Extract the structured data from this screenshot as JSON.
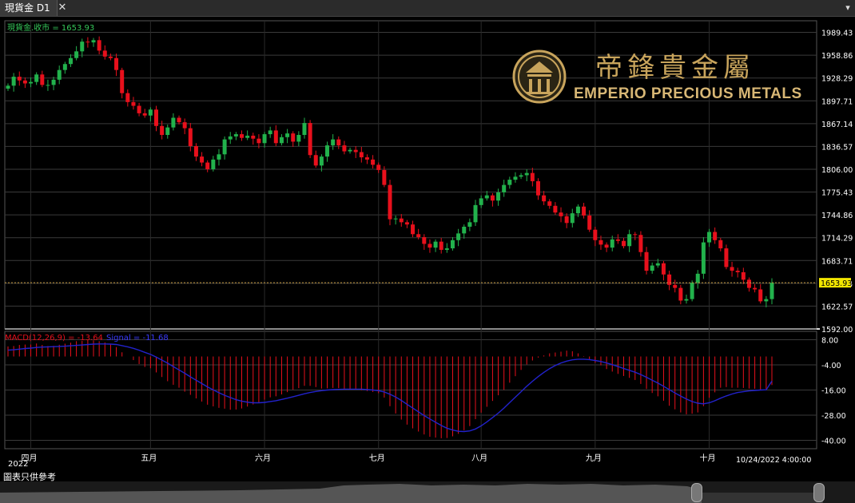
{
  "tab": {
    "title": "現貨金 D1",
    "close": "✕",
    "menu": "▾"
  },
  "disclaimer": "圖表只供參考",
  "logo": {
    "cn": "帝鋒貴金屬",
    "en": "EMPERIO PRECIOUS METALS"
  },
  "chart_data": [
    {
      "type": "candlestick",
      "title": "現貨金.收市 = 1653.93",
      "current_price": 1653.93,
      "ylim": [
        1592.0,
        2005.0
      ],
      "y_ticks": [
        1989.43,
        1958.86,
        1928.29,
        1897.71,
        1867.14,
        1836.57,
        1806.0,
        1775.43,
        1744.86,
        1714.29,
        1683.71,
        1653.14,
        1622.57,
        1592.0
      ],
      "x_tick_labels": [
        "四月",
        "五月",
        "六月",
        "七月",
        "八月",
        "九月",
        "十月"
      ],
      "x_tick_index": [
        4,
        25,
        45,
        65,
        83,
        103,
        123
      ],
      "year_label": "2022",
      "last_date_label": "10/24/2022 4:00:00",
      "colors": {
        "up": "#22b24c",
        "down": "#e8101c",
        "price_line": "#c89a3c",
        "grid": "#3a3a3a",
        "text": "#ffffff"
      },
      "closes": [
        1918,
        1930,
        1925,
        1921,
        1923,
        1933,
        1919,
        1919,
        1926,
        1939,
        1947,
        1955,
        1964,
        1977,
        1976,
        1979,
        1965,
        1957,
        1955,
        1939,
        1908,
        1896,
        1891,
        1881,
        1878,
        1886,
        1864,
        1852,
        1862,
        1875,
        1869,
        1861,
        1837,
        1823,
        1815,
        1806,
        1819,
        1826,
        1846,
        1850,
        1853,
        1848,
        1851,
        1847,
        1841,
        1853,
        1858,
        1841,
        1849,
        1854,
        1843,
        1852,
        1868,
        1825,
        1811,
        1823,
        1838,
        1846,
        1838,
        1830,
        1832,
        1829,
        1822,
        1819,
        1812,
        1805,
        1785,
        1739,
        1740,
        1735,
        1732,
        1719,
        1715,
        1706,
        1701,
        1709,
        1698,
        1700,
        1711,
        1720,
        1729,
        1735,
        1758,
        1767,
        1771,
        1764,
        1775,
        1785,
        1792,
        1796,
        1798,
        1801,
        1790,
        1771,
        1763,
        1757,
        1748,
        1743,
        1734,
        1747,
        1756,
        1744,
        1725,
        1711,
        1705,
        1701,
        1712,
        1710,
        1703,
        1719,
        1718,
        1695,
        1670,
        1677,
        1680,
        1665,
        1651,
        1647,
        1630,
        1632,
        1654,
        1666,
        1708,
        1722,
        1711,
        1700,
        1675,
        1670,
        1668,
        1658,
        1647,
        1645,
        1629,
        1632,
        1653.93
      ],
      "macd": {
        "label": "MACD(12,26,9) = -13.64",
        "signal_label": "Signal = -11.68",
        "value": -13.64,
        "signal": -11.68,
        "ylim": [
          -44.0,
          12.0
        ],
        "y_ticks": [
          8.0,
          -4.0,
          -16.0,
          -28.0,
          -40.0
        ],
        "colors": {
          "histogram": "#e8101c",
          "signal": "#2222cc",
          "label": "#e8101c",
          "signal_label": "#3a3aff"
        },
        "values": [
          4.8,
          5,
          5.5,
          5.7,
          5.7,
          6.2,
          5.5,
          5,
          5.1,
          5.6,
          6.1,
          6.6,
          7.3,
          7.5,
          7.8,
          7.7,
          7.3,
          6.7,
          5.8,
          4.5,
          2,
          0,
          -1.7,
          -3.6,
          -5,
          -5.6,
          -7.6,
          -9.8,
          -11.8,
          -13.5,
          -14.9,
          -16.8,
          -18.3,
          -20,
          -21.5,
          -23,
          -23.8,
          -24.5,
          -24.9,
          -25.4,
          -25.3,
          -24.8,
          -23.9,
          -22.9,
          -21.9,
          -20.6,
          -19.5,
          -19,
          -18.1,
          -17,
          -15.8,
          -15.1,
          -14,
          -14,
          -14.6,
          -15.3,
          -15.2,
          -15,
          -15.1,
          -15.4,
          -15.7,
          -15.8,
          -16.1,
          -16.5,
          -16.9,
          -17.5,
          -19.6,
          -23.7,
          -27.2,
          -30.1,
          -32.5,
          -34.3,
          -35.8,
          -37.2,
          -38.3,
          -38.7,
          -39,
          -38.9,
          -38.1,
          -36.9,
          -35.2,
          -33.2,
          -29.9,
          -26.8,
          -24,
          -21.2,
          -18.5,
          -15.9,
          -12.5,
          -9.4,
          -6.4,
          -3.8,
          -1.9,
          -0.5,
          0.5,
          1.5,
          1.9,
          2.3,
          2.8,
          2.5,
          1.5,
          0.2,
          -1.5,
          -3,
          -4.2,
          -6,
          -7.2,
          -8.3,
          -9.3,
          -10.2,
          -11.2,
          -13.1,
          -15.5,
          -17.4,
          -19,
          -21.1,
          -23.5,
          -25.2,
          -26.7,
          -27.6,
          -27.3,
          -26.7,
          -23.7,
          -19.7,
          -17.1,
          -14.9,
          -14.6,
          -14.9,
          -14.9,
          -15,
          -15.3,
          -15.4,
          -15.8,
          -15.5,
          -13.64
        ],
        "signal_values": [
          3,
          3.2,
          3.5,
          3.8,
          4,
          4.3,
          4.5,
          4.6,
          4.7,
          4.8,
          4.9,
          5.1,
          5.3,
          5.5,
          5.7,
          5.9,
          6,
          6,
          5.9,
          5.7,
          5.2,
          4.6,
          3.9,
          3,
          2,
          1,
          -0.3,
          -1.7,
          -3.2,
          -4.8,
          -6.4,
          -8,
          -9.7,
          -11.3,
          -12.9,
          -14.5,
          -15.9,
          -17.3,
          -18.5,
          -19.6,
          -20.6,
          -21.3,
          -21.8,
          -22.1,
          -22.1,
          -21.9,
          -21.5,
          -21.1,
          -20.5,
          -19.9,
          -19.2,
          -18.5,
          -17.8,
          -17.2,
          -16.7,
          -16.3,
          -16,
          -15.8,
          -15.7,
          -15.6,
          -15.6,
          -15.6,
          -15.6,
          -15.8,
          -16,
          -16.3,
          -16.9,
          -18,
          -19.3,
          -21,
          -22.8,
          -24.6,
          -26.4,
          -28.2,
          -29.8,
          -31.4,
          -32.9,
          -34.2,
          -35.1,
          -35.7,
          -35.8,
          -35.5,
          -34.6,
          -33.1,
          -31.2,
          -29.2,
          -27,
          -24.6,
          -22,
          -19.4,
          -16.8,
          -14.2,
          -11.8,
          -9.6,
          -7.6,
          -5.8,
          -4.3,
          -3.1,
          -2.2,
          -1.6,
          -1.3,
          -1.3,
          -1.5,
          -1.9,
          -2.4,
          -3.1,
          -3.9,
          -4.8,
          -5.7,
          -6.6,
          -7.5,
          -8.6,
          -9.9,
          -11.3,
          -12.7,
          -14.2,
          -15.8,
          -17.4,
          -18.9,
          -20.3,
          -21.5,
          -22.3,
          -22.6,
          -22.1,
          -21.1,
          -19.9,
          -18.8,
          -17.9,
          -17.2,
          -16.8,
          -16.4,
          -16.2,
          -16,
          -15.9,
          -11.68
        ]
      }
    }
  ]
}
